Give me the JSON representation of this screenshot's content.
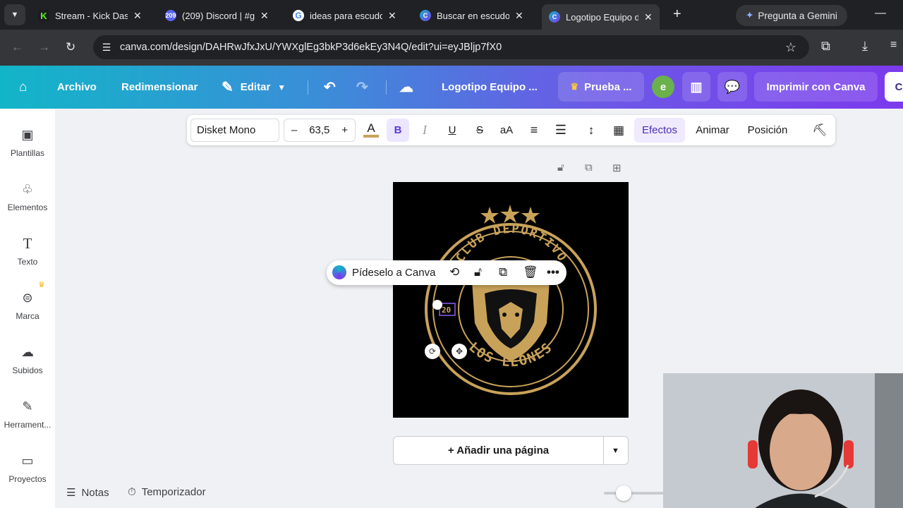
{
  "browser": {
    "tabs": [
      {
        "title": "Stream - Kick Dash",
        "favicon": "kick-icon",
        "active": false
      },
      {
        "title": "(209) Discord | #g",
        "favicon": "discord-icon",
        "badge": "209",
        "active": false
      },
      {
        "title": "ideas para escudo",
        "favicon": "google-icon",
        "active": false
      },
      {
        "title": "Buscar en escudo",
        "favicon": "canva-icon",
        "active": false
      },
      {
        "title": "Logotipo Equipo d",
        "favicon": "canva-icon",
        "active": true
      }
    ],
    "gemini_label": "Pregunta a Gemini",
    "url": "canva.com/design/DAHRwJfxJxU/YWXglEg3bkP3d6ekEy3N4Q/edit?ui=eyJBljp7fX0"
  },
  "header": {
    "archivo": "Archivo",
    "redimensionar": "Redimensionar",
    "editar": "Editar",
    "doc_title": "Logotipo Equipo ...",
    "trial": "Prueba ...",
    "avatar_letter": "e",
    "print": "Imprimir con Canva",
    "share_partial": "C"
  },
  "sidebar": {
    "items": [
      {
        "label": "Plantillas",
        "icon": "templates-icon"
      },
      {
        "label": "Elementos",
        "icon": "elements-icon"
      },
      {
        "label": "Texto",
        "icon": "text-icon"
      },
      {
        "label": "Marca",
        "icon": "brand-icon"
      },
      {
        "label": "Subidos",
        "icon": "uploads-icon"
      },
      {
        "label": "Herrament...",
        "icon": "tools-icon"
      },
      {
        "label": "Proyectos",
        "icon": "projects-icon"
      }
    ]
  },
  "toolbar": {
    "font": "Disket Mono",
    "size": "63,5",
    "efectos": "Efectos",
    "animar": "Animar",
    "posicion": "Posición"
  },
  "canvas": {
    "logo_top_text": "CLUB DEPORTIVO",
    "logo_bottom_text": "LOS LEONES",
    "selected_text": "20",
    "accent_gold": "#c9a25a"
  },
  "context_menu": {
    "ask_label": "Pídeselo a Canva"
  },
  "add_page": "+ Añadir una página",
  "footer": {
    "notas": "Notas",
    "temporizador": "Temporizador"
  }
}
